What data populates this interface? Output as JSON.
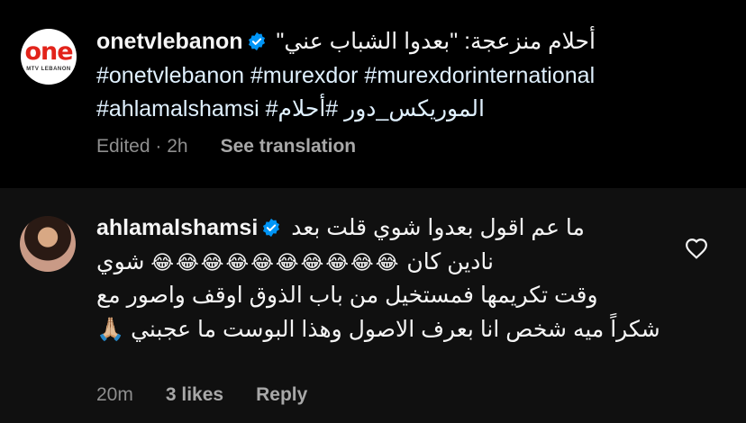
{
  "post": {
    "avatar_logo": "one",
    "avatar_sub": "MTV LEBANON",
    "username": "onetvlebanon",
    "caption_line1": "أحلام منزعجة: \"بعدوا الشباب عني\"",
    "hashtags_line2": "#onetvlebanon #murexdor #murexdorinternational",
    "hashtags_line3": "#ahlamalshamsi #الموريكس_دور #أحلام",
    "edited_label": "Edited · 2h",
    "see_translation_label": "See translation"
  },
  "comment": {
    "username": "ahlamalshamsi",
    "text_line1": "ما عم اقول بعدوا شوي قلت بعد",
    "text_line2_word": "شوي",
    "text_line2_emojis": "😂😂😂😂😂😂😂😂😂😂",
    "text_line2_end": "نادين كان",
    "text_line3": "وقت تكريمها فمستخيل من باب الذوق اوقف واصور مع",
    "text_line4": "ميه شخص انا بعرف الاصول وهذا البوست ما عجبني 🙏🏼",
    "text_line5": "شكراً",
    "time_label": "20m",
    "likes_label": "3 likes",
    "reply_label": "Reply"
  },
  "colors": {
    "background": "#000000",
    "comment_background": "#101010",
    "verified_blue": "#0095f6",
    "meta_gray": "#8e8e8e",
    "logo_red": "#e2231a"
  },
  "icons": {
    "verified": "verified-badge-icon",
    "heart": "heart-outline-icon"
  }
}
